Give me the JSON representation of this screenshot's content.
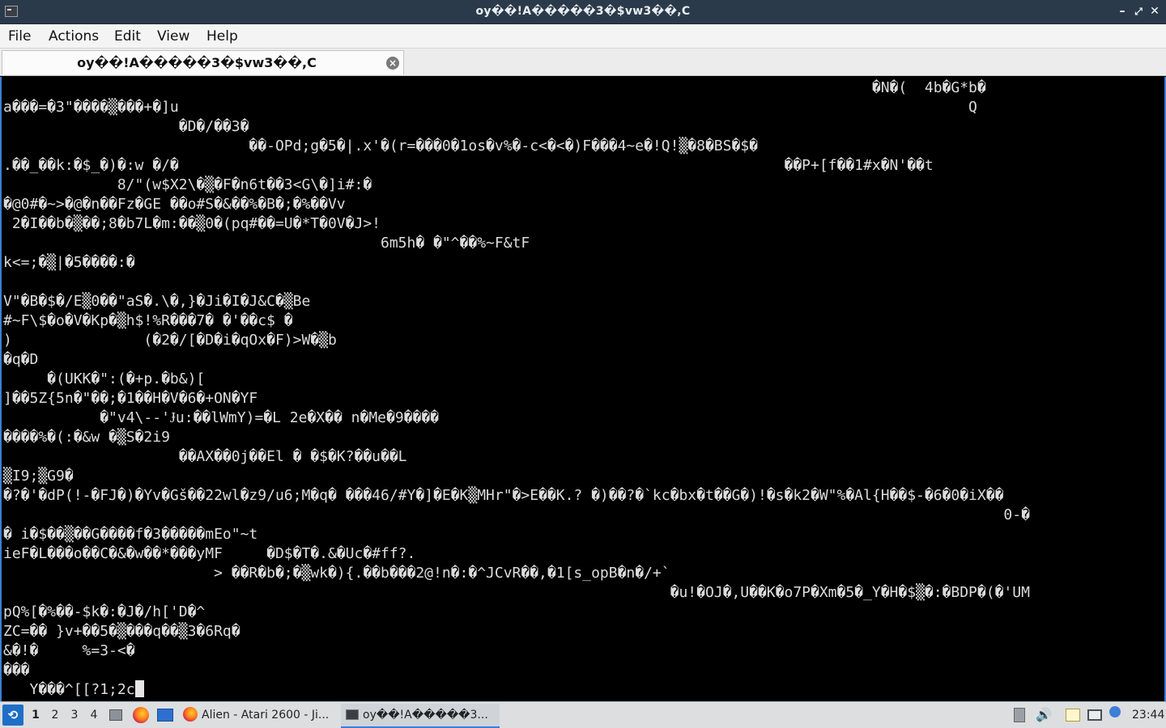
{
  "window": {
    "title": "oy��!A�����3�$vw3��,C",
    "minimize_glyph": "–",
    "maximize_glyph": "⤢",
    "close_glyph": "✕"
  },
  "menubar": {
    "items": [
      "File",
      "Actions",
      "Edit",
      "View",
      "Help"
    ]
  },
  "tab": {
    "label": "oy��!A�����3�$vw3��,C",
    "close_glyph": "×"
  },
  "terminal": {
    "lines": [
      "                                                                                                   �N�(  4b�G*b�",
      "a���=�3\"����▒���+�]u                                                                                          Q",
      "                    �D�/��3�",
      "                            ��-OPd;g�5�|.x'�(r=���0�1os�v%�-c<�<�)F���4~e�!Q!▒�8�BS�$�",
      ".��_��k:�$_�)�:w �/�                                                                     ��P+[f��1#x�N'��t",
      "             8/\"(w$X2\\�▒�F�n6t��3<G\\�]i#:�",
      "�@0#�~>�@�n��Fz�GE ��o#S�&��%�B�;�%��Vv",
      " 2�I��b�▒��;8�b7L�m:��▒0�(pq#��=U�*T�0V�J>!",
      "                                           6m5h� �\"^��%~F&tF",
      "k<=;�▒|�5����:�",
      "",
      "V\"�B�$�/E▒0��\"aS�.\\�,}�Ji�I�J&C�▒Be",
      "#~F\\$�o�V�Kp�▒h$!%R���7� �'��c$ �",
      ")               (�2�/[�D�i�qOx�F)>W�▒b",
      "�q�D",
      "     �(UKK�\":(�+p.�b&)[",
      "]��5Z{5n�\"��;�1��H�V�6�+ON�YF",
      "           �\"v4\\--'Ɉu:��lWmY)=�L 2e�X�� n�Me�9����",
      "����%�(:�&w �▒S�2i9",
      "                    ��AX��0j��El � �$�K?��u��L",
      "▒I9;▒G9�",
      "�?�'�dP(!-�FJ�)�Yv�Gš��22wl�z9/u6;M�q� ���46/#Y�]�E�K▒MHr\"�>E��K.? �)��?�`kc�bx�t��G�)!�s�k2�W\"%�Al{H��$-�6�0�iX��",
      "                                                                                                                  0-�",
      "� i�$��▒��G����f�3�����mEo\"~t",
      "ieF�L���o��C�&�w��*���yMF     �D$�T�.&�Uc�#ff?.",
      "                        > ��R�b�;�▒wk�){.��b���2@!n�:�^JCvR��,�1[s_opB�n�/+`",
      "                                                                            �u!�OJ�,U��K�o7P�Xm�5�_Y�H�$▒�:�BDP�(�'UM",
      "pQ%[�%��-$k�:�J�/h['D�^",
      "ZC=�� }v+��5�▒���q��▒3�6Rq�",
      "&�!�     %=3-<�",
      "���",
      "   Y���^[[?1;2c"
    ]
  },
  "taskbar": {
    "start_icon": "start-menu-icon",
    "workspaces": [
      "1",
      "2",
      "3",
      "4"
    ],
    "active_workspace": "1",
    "tasks": [
      {
        "label": "Alien - Atari 2600 - Ji...",
        "icon": "firefox-icon"
      },
      {
        "label": "oy��!A�����3...",
        "icon": "terminal-icon"
      }
    ],
    "clock": "23:44"
  },
  "colors": {
    "titlebar": "#2b3a4a",
    "accent": "#3d7fd6",
    "terminal_bg": "#000000",
    "terminal_fg": "#dcdcdc",
    "taskbar": "#dcdee0"
  }
}
